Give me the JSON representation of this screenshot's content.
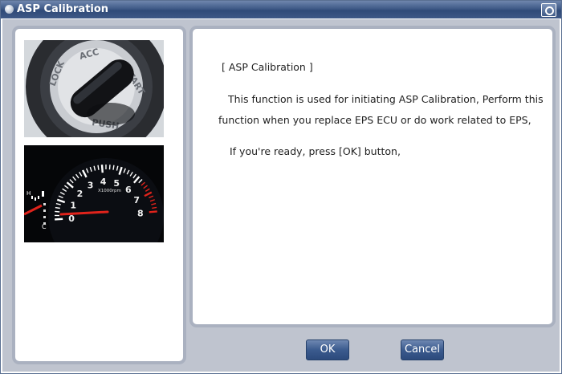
{
  "window": {
    "title": "ASP Calibration"
  },
  "left_panel": {
    "ignition_photo": {
      "labels": [
        "LOCK",
        "ACC",
        "START",
        "PUSH"
      ]
    },
    "tachometer_photo": {
      "ticks": [
        "0",
        "1",
        "2",
        "3",
        "4",
        "5",
        "6",
        "7",
        "8"
      ],
      "unit": "X1000rpm",
      "aux_labels": [
        "H",
        "C"
      ]
    }
  },
  "message": {
    "heading": "[ ASP Calibration ]",
    "line1": "This function is used for initiating ASP Calibration, Perform this",
    "line2": "function when you replace EPS ECU or do work related to EPS,",
    "line3": "If you're ready, press [OK] button,"
  },
  "buttons": {
    "ok": "OK",
    "cancel": "Cancel"
  },
  "colors": {
    "titlebar": "#3f5a87",
    "frame": "#bfc4cf",
    "panel_border": "#aab1c0",
    "button": "#3b5b8e",
    "needle": "#e0231b"
  }
}
